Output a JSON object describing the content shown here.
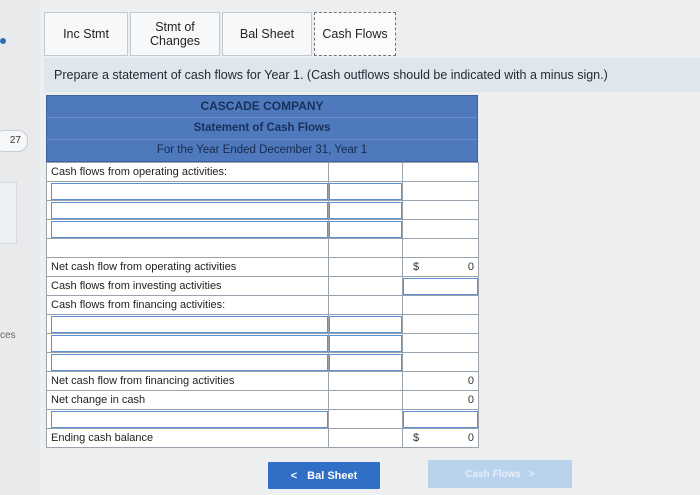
{
  "tabs": [
    {
      "label": "Inc Stmt"
    },
    {
      "label": "Stmt of\nChanges"
    },
    {
      "label": "Bal Sheet"
    },
    {
      "label": "Cash Flows"
    }
  ],
  "instruction": "Prepare a statement of cash flows for Year 1. (Cash outflows should be indicated with a minus sign.)",
  "header": {
    "company": "CASCADE COMPANY",
    "title": "Statement of Cash Flows",
    "period": "For the Year Ended December 31, Year 1"
  },
  "rows": {
    "operating_heading": "Cash flows from operating activities:",
    "net_operating": "Net cash flow from operating activities",
    "investing": "Cash flows from investing activities",
    "financing_heading": "Cash flows from financing activities:",
    "net_financing": "Net cash flow from financing activities",
    "net_change": "Net change in cash",
    "ending": "Ending cash balance"
  },
  "values": {
    "net_operating_currency": "$",
    "net_operating": "0",
    "net_financing": "0",
    "net_change": "0",
    "ending_currency": "$",
    "ending": "0"
  },
  "gutter": {
    "question_number": "27",
    "side_text": "ces"
  },
  "nav": {
    "prev_label": "Bal Sheet",
    "next_label": "Cash Flows",
    "prev_arrow": "<",
    "next_arrow": ">"
  },
  "colors": {
    "header_blue": "#4f79bd",
    "button_blue": "#2f6fc6",
    "input_border": "#5d8fd4"
  }
}
